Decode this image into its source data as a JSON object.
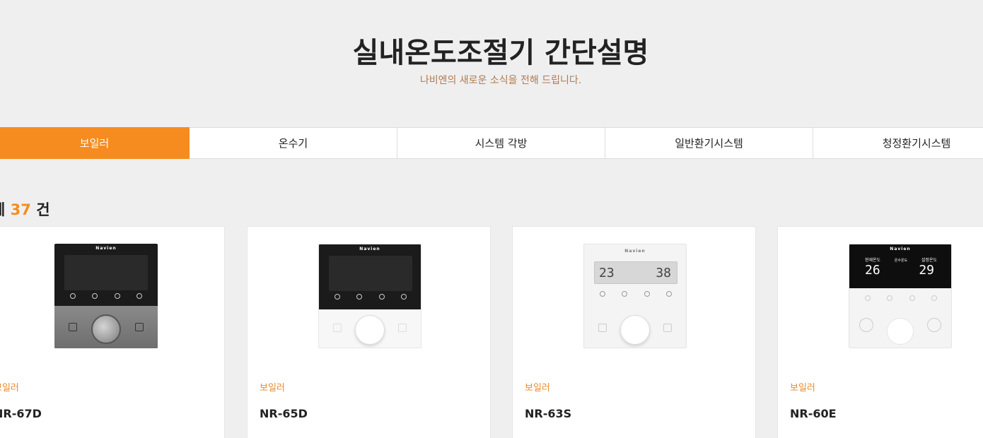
{
  "header": {
    "title": "실내온도조절기 간단설명",
    "subtitle": "나비엔의 새로운 소식을 전해 드립니다."
  },
  "tabs": [
    {
      "label": "보일러",
      "active": true
    },
    {
      "label": "온수기",
      "active": false
    },
    {
      "label": "시스템 각방",
      "active": false
    },
    {
      "label": "일반환기시스템",
      "active": false
    },
    {
      "label": "청정환기시스템",
      "active": false
    }
  ],
  "count": {
    "prefix": "체",
    "number": "37",
    "suffix": "건"
  },
  "products": [
    {
      "category": "보일러",
      "name": "NR-67D",
      "brand": "Navien",
      "style": "dark-metal"
    },
    {
      "category": "보일러",
      "name": "NR-65D",
      "brand": "Navien",
      "style": "dark-white"
    },
    {
      "category": "보일러",
      "name": "NR-63S",
      "brand": "Navien",
      "style": "white-lcd"
    },
    {
      "category": "보일러",
      "name": "NR-60E",
      "brand": "Navien",
      "style": "black-led"
    }
  ],
  "device_labels": {
    "nr63s_left_temp": "23",
    "nr63s_right_temp": "38",
    "nr60e_left_label": "현재온도",
    "nr60e_mid_label": "온수온도",
    "nr60e_right_label": "설정온도",
    "nr60e_left_temp": "26",
    "nr60e_right_temp": "29"
  },
  "colors": {
    "accent": "#f68c1f",
    "subtitle": "#b07b52",
    "category": "#e88a2e"
  }
}
